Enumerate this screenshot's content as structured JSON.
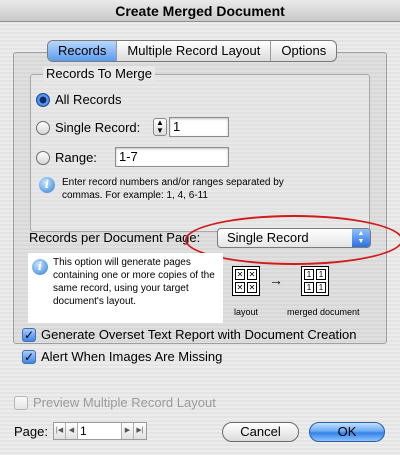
{
  "window": {
    "title": "Create Merged Document"
  },
  "tabs": [
    {
      "label": "Records",
      "active": true
    },
    {
      "label": "Multiple Record Layout",
      "active": false
    },
    {
      "label": "Options",
      "active": false
    }
  ],
  "records_to_merge": {
    "title": "Records To Merge",
    "all_records_label": "All Records",
    "single_record_label": "Single Record:",
    "single_record_value": "1",
    "range_label": "Range:",
    "range_value": "1-7",
    "info_text": "Enter record numbers and/or ranges separated by commas. For example: 1, 4, 6-11",
    "selected": "All Records"
  },
  "records_per_page": {
    "label": "Records per Document Page:",
    "selected": "Single Record",
    "info_text": "This option will generate pages containing one or more copies of the same record, using your target document's layout.",
    "diagram_layout_label": "layout",
    "diagram_merged_label": "merged document"
  },
  "options": {
    "overset_label": "Generate Overset Text Report with Document Creation",
    "overset_checked": true,
    "alert_label": "Alert When Images Are Missing",
    "alert_checked": true,
    "preview_label": "Preview Multiple Record Layout",
    "preview_checked": false,
    "preview_enabled": false
  },
  "page_nav": {
    "label": "Page:",
    "value": "1"
  },
  "buttons": {
    "cancel": "Cancel",
    "ok": "OK"
  },
  "colors": {
    "highlight_ellipse": "#d21a1a",
    "accent": "#3582e7"
  }
}
